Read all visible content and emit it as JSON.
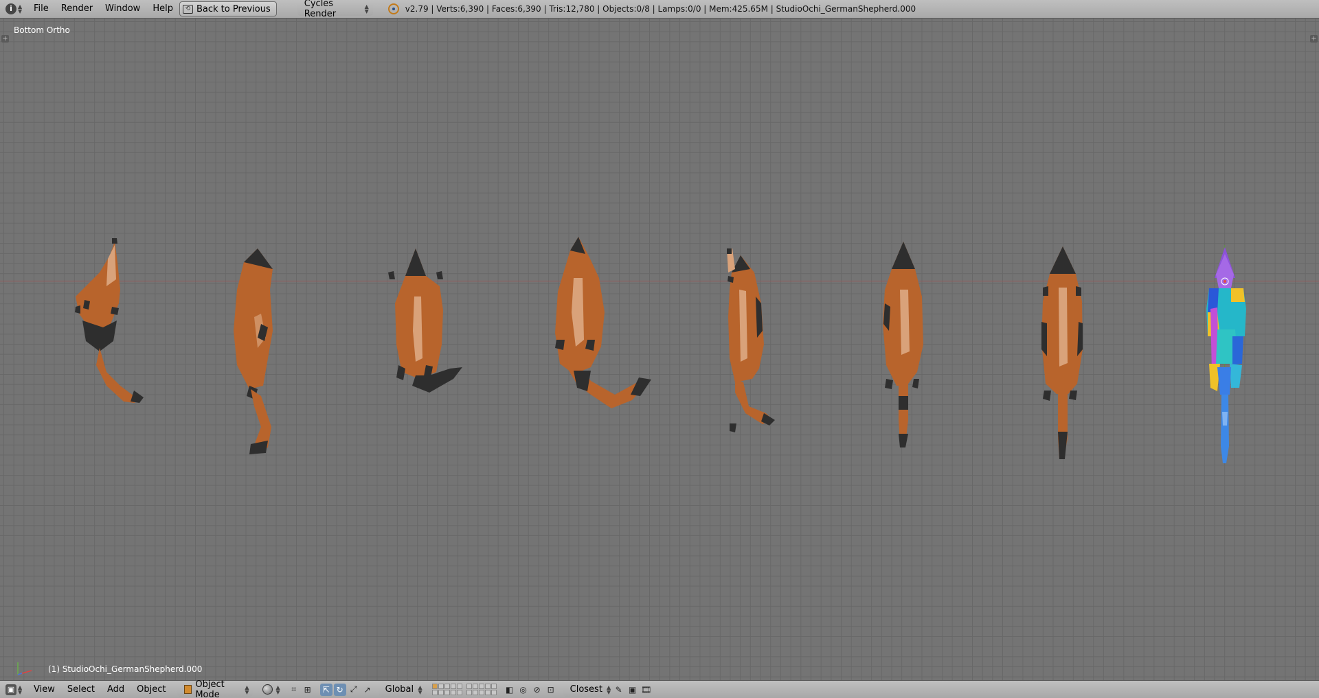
{
  "top_bar": {
    "menus": [
      "File",
      "Render",
      "Window",
      "Help"
    ],
    "back_button": "Back to Previous",
    "render_engine": "Cycles Render",
    "stats": "v2.79 | Verts:6,390 | Faces:6,390 | Tris:12,780 | Objects:0/8 | Lamps:0/0 | Mem:425.65M | StudioOchi_GermanShepherd.000"
  },
  "viewport": {
    "view_label": "Bottom Ortho",
    "active_object": "(1) StudioOchi_GermanShepherd.000"
  },
  "bottom_bar": {
    "menus": [
      "View",
      "Select",
      "Add",
      "Object"
    ],
    "mode": "Object Mode",
    "orientation": "Global",
    "snap_element": "Closest"
  },
  "colors": {
    "dog_fur": "#b8642c",
    "dog_tan": "#d9a27a",
    "dog_dark": "#2e2e2e",
    "grid_bg": "#747474",
    "header_bg": "#b3b3b3"
  }
}
